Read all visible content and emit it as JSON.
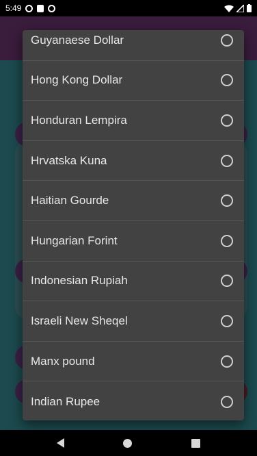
{
  "status_bar": {
    "time": "5:49"
  },
  "currency_dialog": {
    "items": [
      {
        "label": "Guyanaese Dollar"
      },
      {
        "label": "Hong Kong Dollar"
      },
      {
        "label": "Honduran Lempira"
      },
      {
        "label": "Hrvatska Kuna"
      },
      {
        "label": "Haitian Gourde"
      },
      {
        "label": "Hungarian Forint"
      },
      {
        "label": "Indonesian Rupiah"
      },
      {
        "label": "Israeli New Sheqel"
      },
      {
        "label": "Manx pound"
      },
      {
        "label": "Indian Rupee"
      }
    ]
  },
  "colors": {
    "dialog_bg": "#424242",
    "header_bg": "#3a1c3c",
    "content_bg": "#1c4a4e"
  }
}
